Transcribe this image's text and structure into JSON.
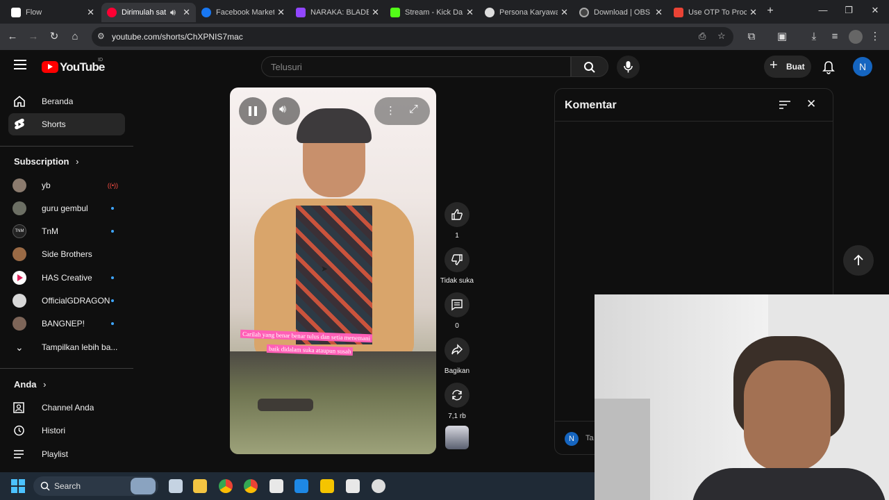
{
  "browser": {
    "tabs": [
      {
        "title": "Flow",
        "color": "#ffffff"
      },
      {
        "title": "Dirimulah sat",
        "color": "#ff0033",
        "active": true
      },
      {
        "title": "Facebook Market",
        "color": "#1877f2"
      },
      {
        "title": "NARAKA: BLADEF",
        "color": "#9146ff"
      },
      {
        "title": "Stream - Kick Da",
        "color": "#53fc18"
      },
      {
        "title": "Persona Karyawa",
        "color": "#dddddd"
      },
      {
        "title": "Download | OBS",
        "color": "#888888"
      },
      {
        "title": "Use OTP To Proc",
        "color": "#ea4335"
      }
    ],
    "url": "youtube.com/shorts/ChXPNIS7mac"
  },
  "youtube": {
    "logo_text": "YouTube",
    "region": "ID",
    "search_placeholder": "Telusuri",
    "create_label": "Buat",
    "account_initial": "N",
    "accent": "#ff0000"
  },
  "sidebar": {
    "main": [
      {
        "label": "Beranda",
        "icon": "home-icon"
      },
      {
        "label": "Shorts",
        "icon": "shorts-icon",
        "active": true
      }
    ],
    "subscription_title": "Subscription",
    "subscriptions": [
      {
        "label": "yb",
        "live": true
      },
      {
        "label": "guru gembul",
        "new": true
      },
      {
        "label": "TnM",
        "new": true
      },
      {
        "label": "Side Brothers"
      },
      {
        "label": "HAS Creative",
        "new": true
      },
      {
        "label": "OfficialGDRAGON",
        "new": true
      },
      {
        "label": "BANGNEP!",
        "new": true
      }
    ],
    "show_more": "Tampilkan lebih ba...",
    "you_title": "Anda",
    "you_items": [
      {
        "label": "Channel Anda",
        "icon": "channel-icon"
      },
      {
        "label": "Histori",
        "icon": "history-icon"
      },
      {
        "label": "Playlist",
        "icon": "playlist-icon"
      }
    ]
  },
  "short": {
    "caption_line1": "Carilah yang benar benar tulus dan setia menemani",
    "caption_line2": "baik didalam suka ataupun susah",
    "like_count": "1",
    "dislike_label": "Tidak suka",
    "comment_count": "0",
    "share_label": "Bagikan",
    "remix_count": "7,1 rb"
  },
  "comments": {
    "title": "Komentar",
    "input_placeholder": "Ta",
    "user_initial": "N"
  },
  "taskbar": {
    "search_label": "Search"
  }
}
